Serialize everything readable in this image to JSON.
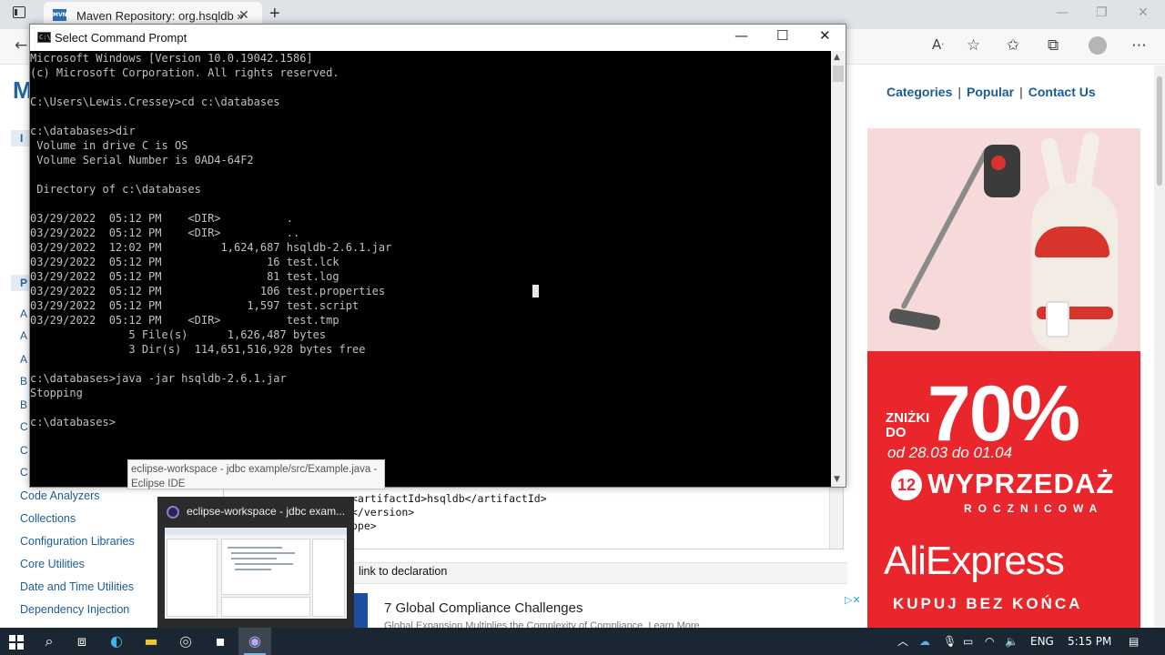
{
  "browser": {
    "tab_title": "Maven Repository: org.hsqldb »",
    "favicon": "MVN",
    "new_tab": "+",
    "close_tab": "✕",
    "window_controls": [
      "—",
      "❐",
      "✕"
    ]
  },
  "page": {
    "logo": "M",
    "side_tab_top": "I",
    "side_tab_mid": "P",
    "header_links": [
      "Categories",
      "Popular",
      "Contact Us"
    ],
    "header_sep": "|",
    "category_letters": [
      "A",
      "A",
      "A",
      "B",
      "B",
      "C",
      "C",
      "C"
    ],
    "categories": [
      "Code Analyzers",
      "Collections",
      "Configuration Libraries",
      "Core Utilities",
      "Date and Time Utilities",
      "Dependency Injection"
    ],
    "xml_lines": [
      "<artifactId>hsqldb</artifactId>",
      "</version>",
      "ope>"
    ],
    "include_label": "link to declaration",
    "ad_title": "7 Global Compliance Challenges",
    "ad_subtitle": "Global Expansion Multiplies the Complexity of Compliance. Learn More"
  },
  "ad": {
    "znizki": "ZNIŻKI",
    "do": "DO",
    "percent": "70%",
    "dates": "od 28.03 do 01.04",
    "badge": "12",
    "sale": "WYPRZEDAŻ",
    "sale_sub": "ROCZNICOWA",
    "brand": "AliExpress",
    "slogan": "KUPUJ BEZ KOŃCA"
  },
  "cmd": {
    "title": "Select Command Prompt",
    "icon_text": "C:\\",
    "minimize": "—",
    "maximize": "☐",
    "close": "✕",
    "lines": [
      "Microsoft Windows [Version 10.0.19042.1586]",
      "(c) Microsoft Corporation. All rights reserved.",
      "",
      "C:\\Users\\Lewis.Cressey>cd c:\\databases",
      "",
      "c:\\databases>dir",
      " Volume in drive C is OS",
      " Volume Serial Number is 0AD4-64F2",
      "",
      " Directory of c:\\databases",
      "",
      "03/29/2022  05:12 PM    <DIR>          .",
      "03/29/2022  05:12 PM    <DIR>          ..",
      "03/29/2022  12:02 PM         1,624,687 hsqldb-2.6.1.jar",
      "03/29/2022  05:12 PM                16 test.lck",
      "03/29/2022  05:12 PM                81 test.log",
      "03/29/2022  05:12 PM               106 test.properties",
      "03/29/2022  05:12 PM             1,597 test.script",
      "03/29/2022  05:12 PM    <DIR>          test.tmp",
      "               5 File(s)      1,626,487 bytes",
      "               3 Dir(s)  114,651,516,928 bytes free",
      "",
      "c:\\databases>java -jar hsqldb-2.6.1.jar",
      "Stopping",
      "",
      "c:\\databases>"
    ]
  },
  "preview": {
    "tooltip": "eclipse-workspace - jdbc example/src/Example.java - Eclipse IDE",
    "title": "eclipse-workspace - jdbc exam..."
  },
  "taskbar": {
    "tray_chevron": "︿",
    "language": "ENG",
    "time": "5:15 PM"
  },
  "colors": {
    "cmd_background": "#000000",
    "cmd_text": "#c0c0c0",
    "link_blue": "#1a5c96",
    "ali_red": "#e8262b",
    "taskbar": "#1b2633"
  }
}
